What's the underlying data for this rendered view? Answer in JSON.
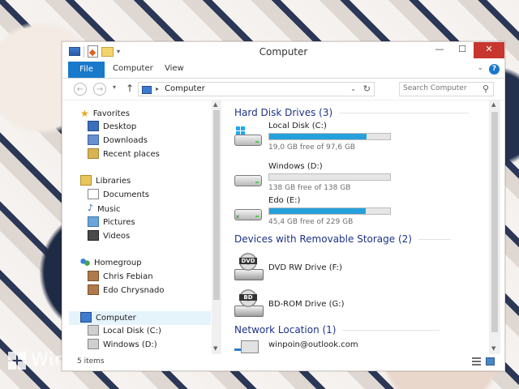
{
  "window": {
    "title": "Computer"
  },
  "ribbon": {
    "tabs": [
      "File",
      "Computer",
      "View"
    ],
    "help": "?"
  },
  "address": {
    "path": "Computer",
    "search_placeholder": "Search Computer"
  },
  "nav": {
    "favorites": {
      "label": "Favorites",
      "items": [
        "Desktop",
        "Downloads",
        "Recent places"
      ]
    },
    "libraries": {
      "label": "Libraries",
      "items": [
        "Documents",
        "Music",
        "Pictures",
        "Videos"
      ]
    },
    "homegroup": {
      "label": "Homegroup",
      "items": [
        "Chris Febian",
        "Edo Chrysnado"
      ]
    },
    "computer": {
      "label": "Computer",
      "items": [
        "Local Disk (C:)",
        "Windows (D:)"
      ]
    }
  },
  "groups": {
    "hdd": "Hard Disk Drives (3)",
    "removable": "Devices with Removable Storage (2)",
    "network": "Network Location (1)"
  },
  "drives": [
    {
      "name": "Local Disk (C:)",
      "free": "19,0 GB free of 97,6 GB",
      "used_fraction": 0.805
    },
    {
      "name": "Windows (D:)",
      "free": "138 GB free of 138 GB",
      "used_fraction": 0.0
    },
    {
      "name": "Edo (E:)",
      "free": "45,4 GB free of 229 GB",
      "used_fraction": 0.802
    }
  ],
  "removable": [
    {
      "name": "DVD RW Drive (F:)",
      "badge": "DVD"
    },
    {
      "name": "BD-ROM Drive (G:)",
      "badge": "BD"
    }
  ],
  "network": [
    {
      "name": "winpoin@outlook.com"
    }
  ],
  "status": {
    "items": "5 items"
  },
  "watermark": "Windows"
}
